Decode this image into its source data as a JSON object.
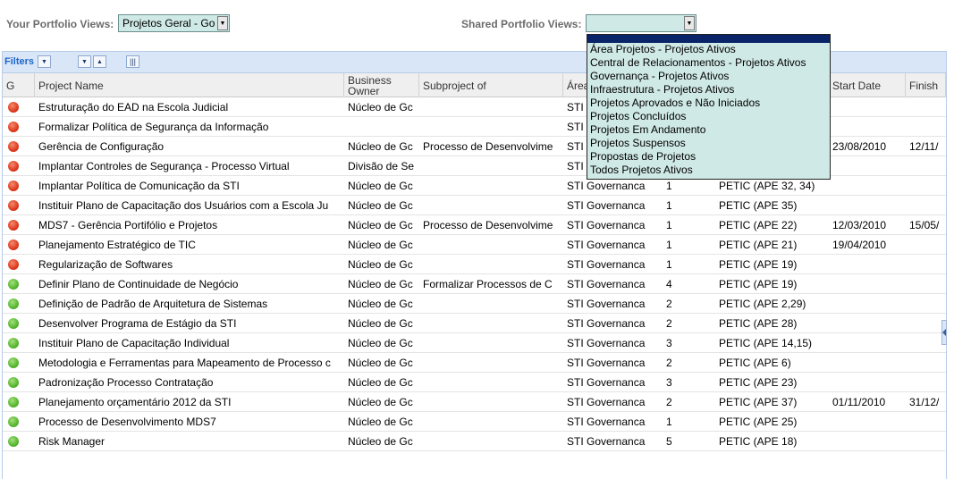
{
  "top": {
    "your_label": "Your Portfolio Views:",
    "your_value": "Projetos Geral - Go",
    "shared_label": "Shared Portfolio Views:",
    "shared_value": ""
  },
  "toolbar": {
    "filters_label": "Filters"
  },
  "columns": {
    "g": "G",
    "project": "Project Name",
    "owner": "Business Owner",
    "subproject": "Subproject of",
    "area": "Área",
    "start": "Start Date",
    "finish": "Finish"
  },
  "rows": [
    {
      "status": "red",
      "name": "Estruturação do EAD na Escola Judicial",
      "owner": "Núcleo de Gc",
      "sub": "",
      "area": "STI",
      "num": "",
      "ref": "",
      "start": "",
      "finish": ""
    },
    {
      "status": "red",
      "name": "Formalizar Política de Segurança da Informação",
      "owner": "",
      "sub": "",
      "area": "STI",
      "num": "",
      "ref": "",
      "start": "",
      "finish": ""
    },
    {
      "status": "red",
      "name": "Gerência de Configuração",
      "owner": "Núcleo de Gc",
      "sub": "Processo de Desenvolvime",
      "area": "STI",
      "num": "",
      "ref": "",
      "start": "23/08/2010",
      "finish": "12/11/"
    },
    {
      "status": "red",
      "name": "Implantar Controles de Segurança - Processo Virtual",
      "owner": "Divisão de Se",
      "sub": "",
      "area": "STI",
      "num": "",
      "ref": "",
      "start": "",
      "finish": ""
    },
    {
      "status": "red",
      "name": "Implantar Política de Comunicação da STI",
      "owner": "Núcleo de Gc",
      "sub": "",
      "area": "STI Governanca",
      "num": "1",
      "ref": "PETIC (APE 32, 34)",
      "start": "",
      "finish": ""
    },
    {
      "status": "red",
      "name": "Instituir Plano de Capacitação dos Usuários com a Escola Ju",
      "owner": "Núcleo de Gc",
      "sub": "",
      "area": "STI Governanca",
      "num": "1",
      "ref": "PETIC (APE 35)",
      "start": "",
      "finish": ""
    },
    {
      "status": "red",
      "name": "MDS7 - Gerência Portifólio e Projetos",
      "owner": "Núcleo de Gc",
      "sub": "Processo de Desenvolvime",
      "area": "STI Governanca",
      "num": "1",
      "ref": "PETIC (APE 22)",
      "start": "12/03/2010",
      "finish": "15/05/"
    },
    {
      "status": "red",
      "name": "Planejamento Estratégico de TIC",
      "owner": "Núcleo de Gc",
      "sub": "",
      "area": "STI Governanca",
      "num": "1",
      "ref": "PETIC (APE 21)",
      "start": "19/04/2010",
      "finish": ""
    },
    {
      "status": "red",
      "name": "Regularização de Softwares",
      "owner": "Núcleo de Gc",
      "sub": "",
      "area": "STI Governanca",
      "num": "1",
      "ref": "PETIC (APE 19)",
      "start": "",
      "finish": ""
    },
    {
      "status": "green",
      "name": "Definir Plano de Continuidade de Negócio",
      "owner": "Núcleo de Gc",
      "sub": "Formalizar Processos de C",
      "area": "STI Governanca",
      "num": "4",
      "ref": "PETIC (APE 19)",
      "start": "",
      "finish": ""
    },
    {
      "status": "green",
      "name": "Definição de Padrão de Arquitetura de Sistemas",
      "owner": "Núcleo de Gc",
      "sub": "",
      "area": "STI Governanca",
      "num": "2",
      "ref": "PETIC (APE 2,29)",
      "start": "",
      "finish": ""
    },
    {
      "status": "green",
      "name": "Desenvolver Programa de Estágio da STI",
      "owner": "Núcleo de Gc",
      "sub": "",
      "area": "STI Governanca",
      "num": "2",
      "ref": "PETIC (APE 28)",
      "start": "",
      "finish": ""
    },
    {
      "status": "green",
      "name": "Instituir Plano de Capacitação Individual",
      "owner": "Núcleo de Gc",
      "sub": "",
      "area": "STI Governanca",
      "num": "3",
      "ref": "PETIC (APE 14,15)",
      "start": "",
      "finish": ""
    },
    {
      "status": "green",
      "name": "Metodologia e Ferramentas para Mapeamento de Processo c",
      "owner": "Núcleo de Gc",
      "sub": "",
      "area": "STI Governanca",
      "num": "2",
      "ref": "PETIC (APE 6)",
      "start": "",
      "finish": ""
    },
    {
      "status": "green",
      "name": "Padronização Processo Contratação",
      "owner": "Núcleo de Gc",
      "sub": "",
      "area": "STI Governanca",
      "num": "3",
      "ref": "PETIC (APE 23)",
      "start": "",
      "finish": ""
    },
    {
      "status": "green",
      "name": "Planejamento orçamentário 2012 da STI",
      "owner": "Núcleo de Gc",
      "sub": "",
      "area": "STI Governanca",
      "num": "2",
      "ref": "PETIC (APE 37)",
      "start": "01/11/2010",
      "finish": "31/12/"
    },
    {
      "status": "green",
      "name": "Processo de Desenvolvimento MDS7",
      "owner": "Núcleo de Gc",
      "sub": "",
      "area": "STI Governanca",
      "num": "1",
      "ref": "PETIC (APE 25)",
      "start": "",
      "finish": ""
    },
    {
      "status": "green",
      "name": "Risk Manager",
      "owner": "Núcleo de Gc",
      "sub": "",
      "area": "STI Governanca",
      "num": "5",
      "ref": "PETIC (APE 18)",
      "start": "",
      "finish": ""
    }
  ],
  "dropdown_options": [
    "Área Projetos - Projetos Ativos",
    "Central de Relacionamentos - Projetos Ativos",
    "Governança - Projetos Ativos",
    "Infraestrutura - Projetos Ativos",
    "Projetos Aprovados e Não Iniciados",
    "Projetos Concluídos",
    "Projetos Em Andamento",
    "Projetos Suspensos",
    "Propostas de Projetos",
    "Todos Projetos Ativos"
  ],
  "colors": {
    "red": "#dd3a1e",
    "green": "#56b62f",
    "toolbar": "#d9e6f7",
    "dropdown": "#cfe9e6",
    "highlight": "#0a246a"
  }
}
